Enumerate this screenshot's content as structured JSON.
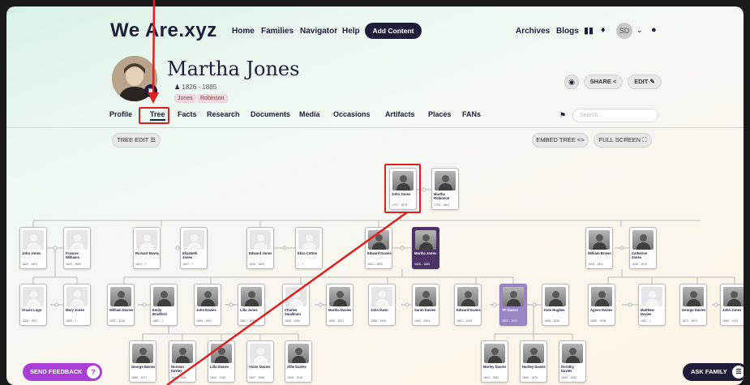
{
  "nav": {
    "logo": "We Are.xyz",
    "links": [
      "Home",
      "Families",
      "Navigator",
      "Help"
    ],
    "add_content": "Add Content",
    "archives": "Archives",
    "blogs": "Blogs",
    "avatar_initials": "SD"
  },
  "profile": {
    "name": "Martha Jones",
    "dates": "1826 - 1885",
    "tags": [
      "Jones",
      "Robinson"
    ],
    "share_label": "SHARE",
    "edit_label": "EDIT"
  },
  "tabs": [
    "Profile",
    "Tree",
    "Facts",
    "Research",
    "Documents",
    "Media",
    "Occasions",
    "Artifacts",
    "Places",
    "FANs"
  ],
  "active_tab": "Tree",
  "search": {
    "placeholder": "Search..."
  },
  "toolbar": {
    "tree_edit": "TREE EDIT",
    "embed_tree": "EMBED TREE",
    "full_screen": "FULL SCREEN"
  },
  "tree": {
    "parents": [
      {
        "name": "John Jones",
        "dates": "1797 - 1878",
        "photo": true
      },
      {
        "name": "Martha Robinson",
        "dates": "1793 - 1863",
        "photo": true
      }
    ],
    "row1": [
      {
        "name": "John Jones",
        "dates": "1820 - 1891",
        "photo": false
      },
      {
        "name": "Frances Williams",
        "dates": "1820 - 1896",
        "photo": false
      },
      {
        "name": "Richard Davey",
        "dates": "1813 - ?",
        "photo": false
      },
      {
        "name": "Elizabeth Jones",
        "dates": "1821 - ?",
        "photo": false
      },
      {
        "name": "Edward Jones",
        "dates": "1824 - 1825",
        "photo": false
      },
      {
        "name": "Eliza Cotton",
        "dates": "? - ?",
        "photo": false
      },
      {
        "name": "Edward Davies",
        "dates": "1821 - 1890",
        "photo": true
      },
      {
        "name": "Martha Jones",
        "dates": "1826 - 1885",
        "photo": true,
        "selected": true
      },
      {
        "name": "William Brown",
        "dates": "1826 - 1891",
        "photo": true
      },
      {
        "name": "Catherine Jones",
        "dates": "1828 - 1915",
        "photo": true
      }
    ],
    "row2": [
      {
        "name": "Orazio Lugo",
        "dates": "1828 - 1907",
        "photo": false
      },
      {
        "name": "Mary Jones",
        "dates": "1855 - ?",
        "photo": false
      },
      {
        "name": "William Davies",
        "dates": "1852 - 1916",
        "photo": true
      },
      {
        "name": "Emily Bradford",
        "dates": "1862 - ?",
        "photo": true
      },
      {
        "name": "John Davies",
        "dates": "1850 - 1931",
        "photo": true
      },
      {
        "name": "Lilla Jones",
        "dates": "1867 - 1945",
        "photo": true
      },
      {
        "name": "Charles Smallman",
        "dates": "1855 - 1900",
        "photo": false
      },
      {
        "name": "Martha Davies",
        "dates": "1858 - 1921",
        "photo": true
      },
      {
        "name": "John Dann",
        "dates": "1856 - 1926",
        "photo": false
      },
      {
        "name": "Sarah Davies",
        "dates": "1860 - 1904",
        "photo": true
      },
      {
        "name": "Edward Davies",
        "dates": "1861 - 1939",
        "photo": true
      },
      {
        "name": "TP Davies",
        "dates": "1852 - 1932",
        "photo": true,
        "lavender": true
      },
      {
        "name": "Kate Hughes",
        "dates": "1866 - 1935",
        "photo": true
      },
      {
        "name": "Agnes Davies",
        "dates": "1865 - 1938",
        "photo": true
      },
      {
        "name": "Matthew Davies",
        "dates": "1867 - ?",
        "photo": false
      },
      {
        "name": "George Davies",
        "dates": "1870 - 1872",
        "photo": true
      },
      {
        "name": "John Jones",
        "dates": "1869 - 1910",
        "photo": true
      }
    ],
    "row3": [
      {
        "name": "George Davies",
        "dates": "1888 - 1917",
        "photo": true
      },
      {
        "name": "Norman Davies",
        "dates": "1890 - 1962",
        "photo": true
      },
      {
        "name": "Lilla Davies",
        "dates": "1894 - 1945",
        "photo": true
      },
      {
        "name": "Victor Davies",
        "dates": "1897 - 1986",
        "photo": false
      },
      {
        "name": "Alfie Davies",
        "dates": "1900 - 1916",
        "photo": true
      },
      {
        "name": "Morley Davies",
        "dates": "1894 - 1981",
        "photo": true
      },
      {
        "name": "Hartley Davies",
        "dates": "1896 - 1976",
        "photo": true
      },
      {
        "name": "Dorothy Davies",
        "dates": "1905 - 1983",
        "photo": true
      }
    ]
  },
  "send_feedback": "SEND FEEDBACK",
  "ask_family": "ASK FAMILY",
  "colors": {
    "navy": "#1d1d3a",
    "selected_card": "#4b3366",
    "highlight_card": "#9a86c4",
    "feedback": "#a93fd6",
    "annotation": "#e02020"
  }
}
